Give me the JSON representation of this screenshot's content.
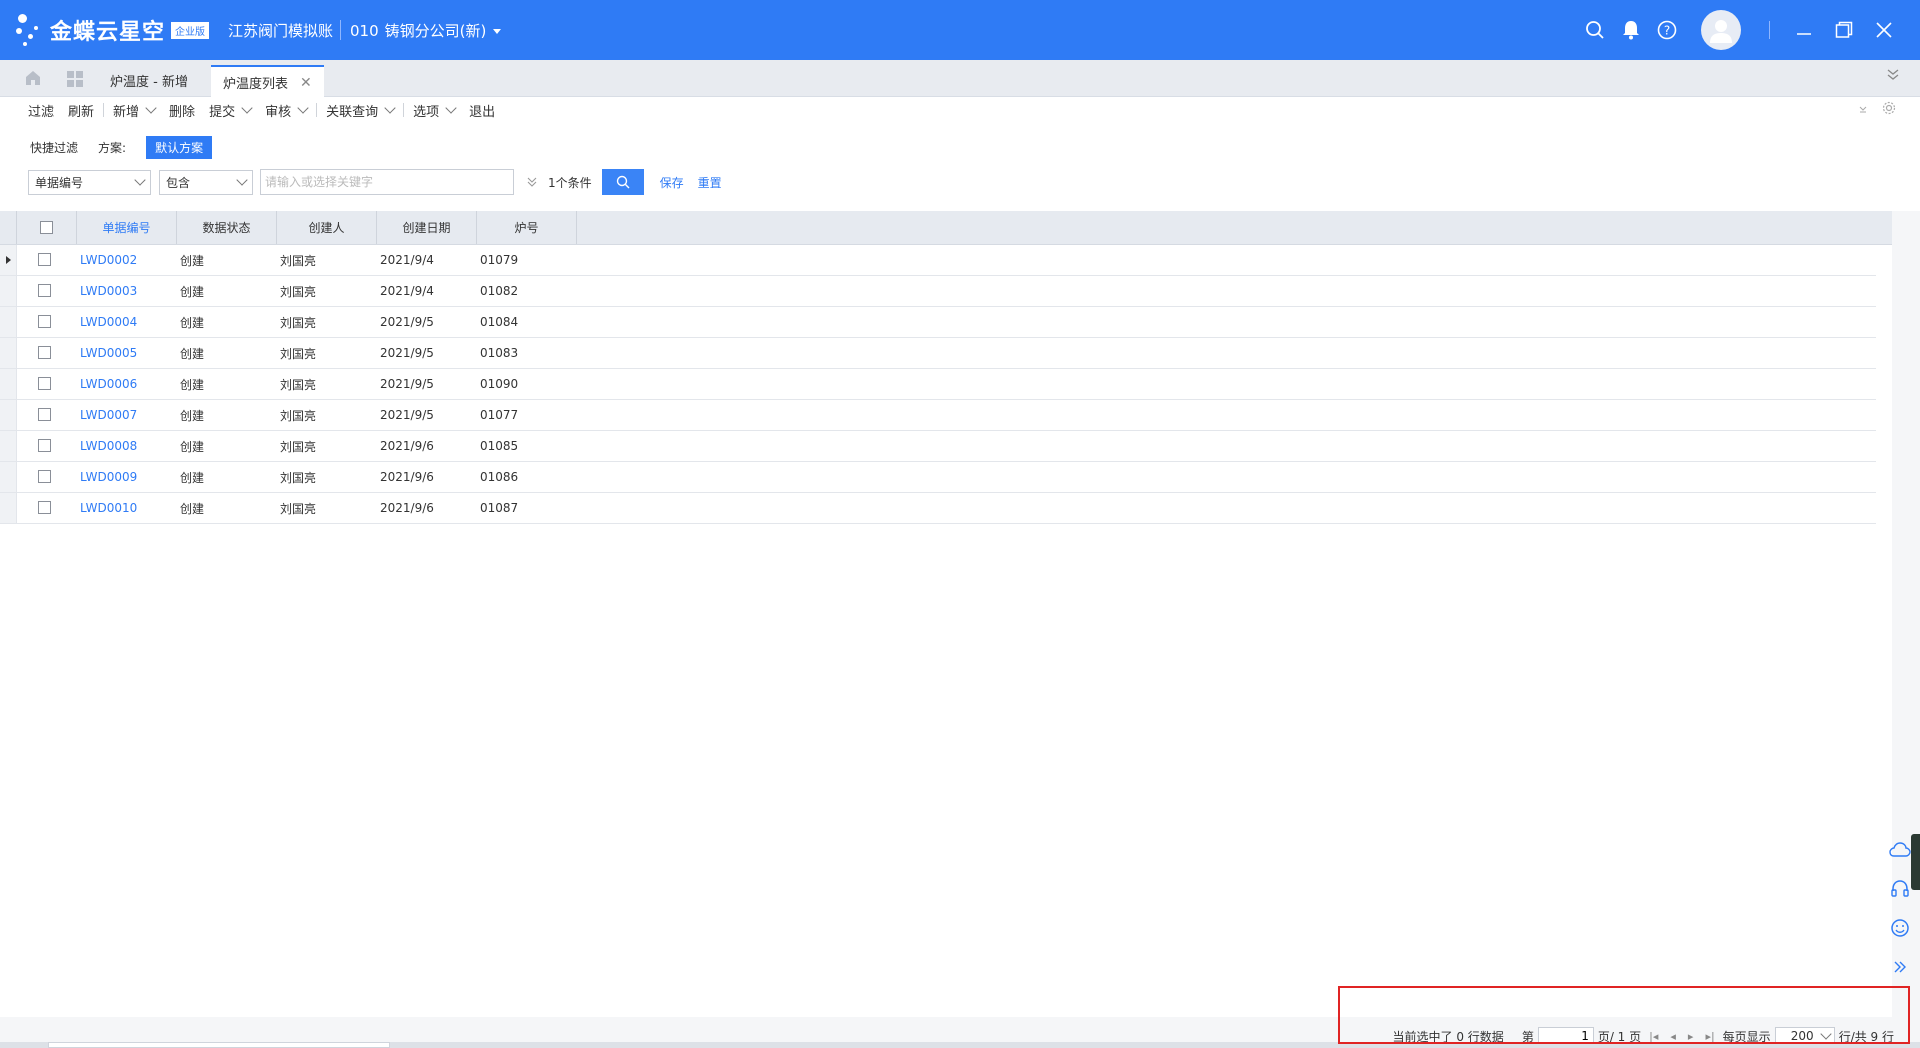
{
  "app": {
    "logo_text": "金蝶云星空",
    "edition": "企业版",
    "account": "江苏阀门模拟账",
    "org_code": "010",
    "org_name": "铸钢分公司(新)"
  },
  "tabs": [
    {
      "label": "炉温度 - 新增"
    },
    {
      "label": "炉温度列表"
    }
  ],
  "toolbar": {
    "filter": "过滤",
    "refresh": "刷新",
    "new": "新增",
    "delete": "删除",
    "submit": "提交",
    "audit": "审核",
    "related_query": "关联查询",
    "options": "选项",
    "exit": "退出"
  },
  "filter": {
    "quick_label": "快捷过滤",
    "scheme_label": "方案:",
    "scheme_default": "默认方案",
    "field": "单据编号",
    "operator": "包含",
    "keyword_placeholder": "请输入或选择关键字",
    "condition_count": "1个条件",
    "save": "保存",
    "reset": "重置"
  },
  "grid": {
    "columns": [
      "单据编号",
      "数据状态",
      "创建人",
      "创建日期",
      "炉号"
    ],
    "rows": [
      [
        "LWD0002",
        "创建",
        "刘国亮",
        "2021/9/4",
        "01079"
      ],
      [
        "LWD0003",
        "创建",
        "刘国亮",
        "2021/9/4",
        "01082"
      ],
      [
        "LWD0004",
        "创建",
        "刘国亮",
        "2021/9/5",
        "01084"
      ],
      [
        "LWD0005",
        "创建",
        "刘国亮",
        "2021/9/5",
        "01083"
      ],
      [
        "LWD0006",
        "创建",
        "刘国亮",
        "2021/9/5",
        "01090"
      ],
      [
        "LWD0007",
        "创建",
        "刘国亮",
        "2021/9/5",
        "01077"
      ],
      [
        "LWD0008",
        "创建",
        "刘国亮",
        "2021/9/6",
        "01085"
      ],
      [
        "LWD0009",
        "创建",
        "刘国亮",
        "2021/9/6",
        "01086"
      ],
      [
        "LWD0010",
        "创建",
        "刘国亮",
        "2021/9/6",
        "01087"
      ]
    ]
  },
  "pager": {
    "selected_text": "当前选中了 0 行数据",
    "page_prefix": "第",
    "page_value": "1",
    "page_suffix": "页/ 1 页",
    "per_page_label": "每页显示",
    "per_page_value": "200",
    "total_text": "行/共 9 行"
  },
  "colors": {
    "brand": "#2f7bf5",
    "highlight": "#e02424"
  },
  "icons": [
    "search-icon",
    "bell-icon",
    "help-icon",
    "avatar-icon",
    "minimize-icon",
    "maximize-icon",
    "close-icon",
    "home-icon",
    "grid-icon",
    "settings-icon",
    "cloud-icon",
    "headset-icon",
    "smile-icon",
    "expand-icon"
  ]
}
